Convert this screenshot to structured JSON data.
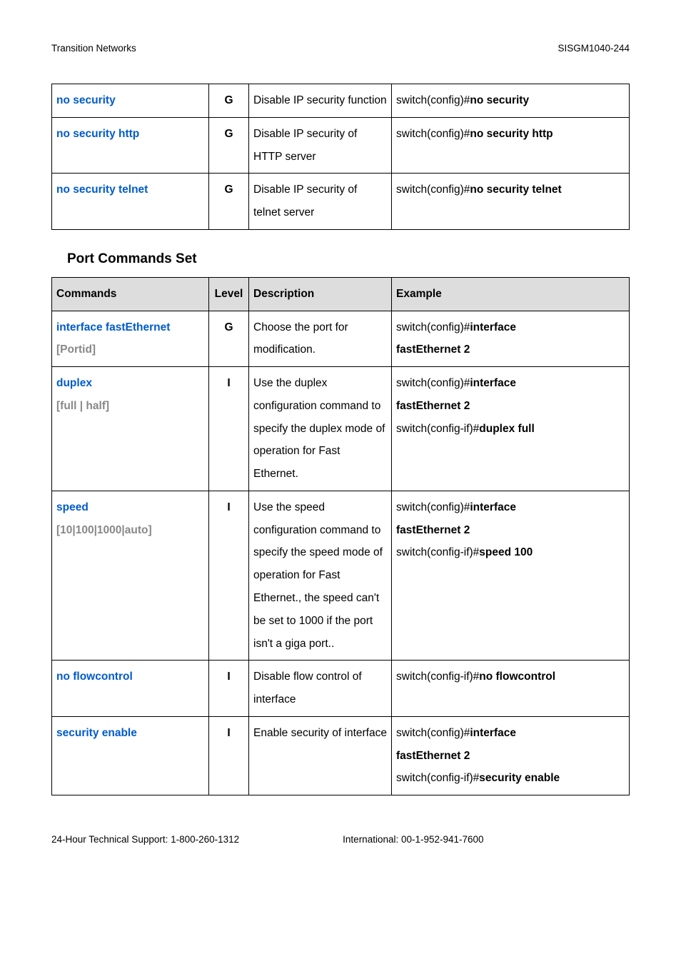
{
  "header": {
    "left": "Transition Networks",
    "right": "SISGM1040-244"
  },
  "table1": {
    "rows": [
      {
        "cmd": "no security",
        "lvl": "G",
        "desc": "Disable IP security function",
        "ex_pre": "switch(config)#",
        "ex_bold": "no security"
      },
      {
        "cmd": "no security http",
        "lvl": "G",
        "desc": "Disable IP security of HTTP server",
        "ex_pre": "switch(config)#",
        "ex_bold": "no security http"
      },
      {
        "cmd": "no security telnet",
        "lvl": "G",
        "desc": "Disable IP security of telnet server",
        "ex_pre": "switch(config)#",
        "ex_bold": "no security telnet"
      }
    ]
  },
  "section2": {
    "title": "Port Commands Set"
  },
  "table2": {
    "head": {
      "c1": "Commands",
      "c2": "Level",
      "c3": "Description",
      "c4": "Example"
    },
    "rows": [
      {
        "cmd_blue": "interface fastEthernet",
        "cmd_gray": "[Portid]",
        "lvl": "G",
        "desc": "Choose the port for modification.",
        "ex": [
          {
            "pre": "switch(config)#",
            "bold": "interface"
          },
          {
            "bold_only": "fastEthernet 2"
          }
        ]
      },
      {
        "cmd_blue": "duplex",
        "cmd_gray": "[full | half]",
        "lvl": "I",
        "desc": "Use the duplex configuration command to specify the duplex mode of operation for Fast Ethernet.",
        "ex": [
          {
            "pre": "switch(config)#",
            "bold": "interface"
          },
          {
            "bold_only": "fastEthernet 2"
          },
          {
            "pre": "switch(config-if)#",
            "bold": "duplex full"
          }
        ]
      },
      {
        "cmd_blue": "speed",
        "cmd_gray": "[10|100|1000|auto]",
        "lvl": "I",
        "desc": "Use the speed configuration command to specify the speed mode of operation for Fast Ethernet., the speed can't be set to 1000 if the port isn't a giga port..",
        "ex": [
          {
            "pre": "switch(config)#",
            "bold": "interface"
          },
          {
            "bold_only": "fastEthernet 2"
          },
          {
            "pre": "switch(config-if)#",
            "bold": "speed 100"
          }
        ]
      },
      {
        "cmd_blue": "no flowcontrol",
        "cmd_gray": "",
        "lvl": "I",
        "desc": "Disable flow control of interface",
        "ex": [
          {
            "pre": "switch(config-if)#",
            "bold": "no flowcontrol"
          }
        ]
      },
      {
        "cmd_blue": "security enable",
        "cmd_gray": "",
        "lvl": "I",
        "desc": "Enable security of interface",
        "ex": [
          {
            "pre": "switch(config)#",
            "bold": "interface"
          },
          {
            "bold_only": "fastEthernet 2"
          },
          {
            "pre": "switch(config-if)#",
            "bold": "security enable"
          }
        ]
      }
    ]
  },
  "footer": {
    "left": "24-Hour Technical Support: 1-800-260-1312",
    "right": "International: 00-1-952-941-7600"
  }
}
